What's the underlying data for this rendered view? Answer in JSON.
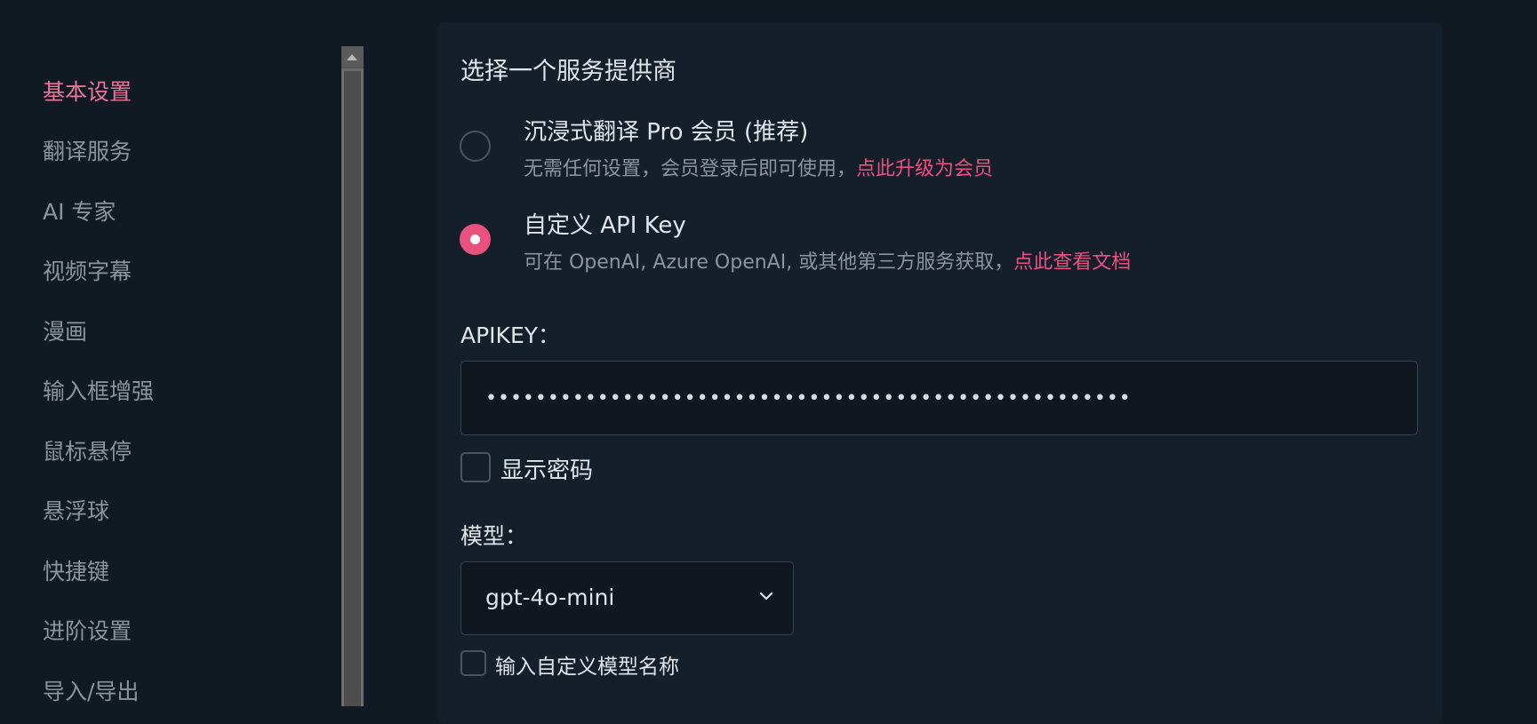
{
  "sidebar": {
    "items": [
      {
        "label": "基本设置",
        "active": true
      },
      {
        "label": "翻译服务",
        "active": false
      },
      {
        "label": "AI 专家",
        "active": false
      },
      {
        "label": "视频字幕",
        "active": false
      },
      {
        "label": "漫画",
        "active": false
      },
      {
        "label": "输入框增强",
        "active": false
      },
      {
        "label": "鼠标悬停",
        "active": false
      },
      {
        "label": "悬浮球",
        "active": false
      },
      {
        "label": "快捷键",
        "active": false
      },
      {
        "label": "进阶设置",
        "active": false
      },
      {
        "label": "导入/导出",
        "active": false
      }
    ]
  },
  "provider": {
    "section_title": "选择一个服务提供商",
    "options": [
      {
        "title": "沉浸式翻译 Pro 会员 (推荐)",
        "description": "无需任何设置，会员登录后即可使用，",
        "link": "点此升级为会员",
        "selected": false
      },
      {
        "title": "自定义 API Key",
        "description": "可在 OpenAI, Azure OpenAI, 或其他第三方服务获取，",
        "link": "点此查看文档",
        "selected": true
      }
    ]
  },
  "apikey": {
    "label": "APIKEY：",
    "value": "••••••••••••••••••••••••••••••••••••••••••••••••••••",
    "show_password_label": "显示密码",
    "show_password_checked": false
  },
  "model": {
    "label": "模型：",
    "selected": "gpt-4o-mini",
    "custom_name_label": "输入自定义模型名称",
    "custom_name_checked": false
  },
  "colors": {
    "accent": "#e9527f",
    "link": "#ec4f82",
    "active_nav": "#e8759b",
    "background": "#111a22",
    "card": "#151f29"
  }
}
